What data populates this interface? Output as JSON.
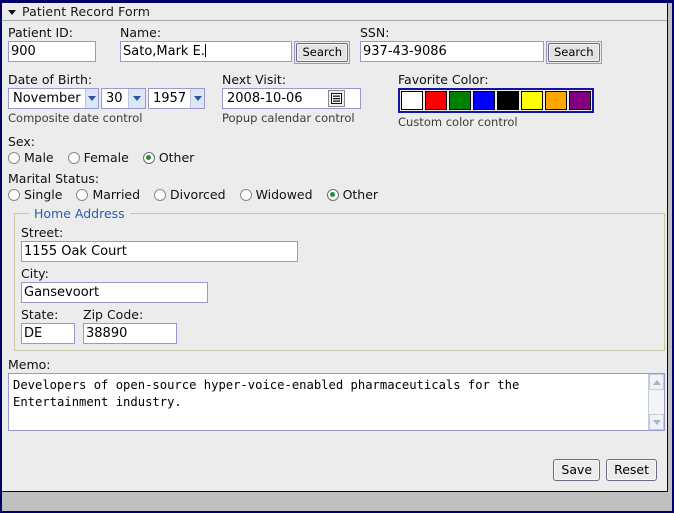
{
  "window": {
    "title": "Patient Record Form",
    "collapse_icon": "triangle-down-icon"
  },
  "fields": {
    "patient_id": {
      "label": "Patient ID:",
      "value": "900"
    },
    "name": {
      "label": "Name:",
      "value": "Sato,Mark E.",
      "search_button": "Search"
    },
    "ssn": {
      "label": "SSN:",
      "value": "937-43-9086",
      "search_button": "Search"
    },
    "dob": {
      "label": "Date of Birth:",
      "hint": "Composite date control",
      "month": "November",
      "day": "30",
      "year": "1957"
    },
    "next_visit": {
      "label": "Next Visit:",
      "hint": "Popup calendar control",
      "value": "2008-10-06",
      "calendar_icon": "calendar-icon"
    },
    "favorite_color": {
      "label": "Favorite Color:",
      "hint": "Custom color control",
      "swatches": [
        {
          "name": "white",
          "hex": "#ffffff",
          "selected": false
        },
        {
          "name": "red",
          "hex": "#ff0000",
          "selected": false
        },
        {
          "name": "green",
          "hex": "#008000",
          "selected": false
        },
        {
          "name": "blue",
          "hex": "#0000ff",
          "selected": false
        },
        {
          "name": "black",
          "hex": "#000000",
          "selected": false
        },
        {
          "name": "yellow",
          "hex": "#ffff00",
          "selected": false
        },
        {
          "name": "orange",
          "hex": "#ffa500",
          "selected": false
        },
        {
          "name": "purple",
          "hex": "#800080",
          "selected": false
        }
      ]
    },
    "sex": {
      "label": "Sex:",
      "options": [
        {
          "label": "Male",
          "selected": false
        },
        {
          "label": "Female",
          "selected": false
        },
        {
          "label": "Other",
          "selected": true
        }
      ]
    },
    "marital_status": {
      "label": "Marital Status:",
      "options": [
        {
          "label": "Single",
          "selected": false
        },
        {
          "label": "Married",
          "selected": false
        },
        {
          "label": "Divorced",
          "selected": false
        },
        {
          "label": "Widowed",
          "selected": false
        },
        {
          "label": "Other",
          "selected": true
        }
      ]
    },
    "home_address": {
      "legend": "Home Address",
      "street": {
        "label": "Street:",
        "value": "1155 Oak Court"
      },
      "city": {
        "label": "City:",
        "value": "Gansevoort"
      },
      "state": {
        "label": "State:",
        "value": "DE"
      },
      "zip": {
        "label": "Zip Code:",
        "value": "38890"
      }
    },
    "memo": {
      "label": "Memo:",
      "value": "Developers of open-source hyper-voice-enabled pharmaceuticals for the\nEntertainment industry."
    }
  },
  "actions": {
    "save": "Save",
    "reset": "Reset"
  },
  "colors": {
    "accent": "#2a5db0",
    "frame": "#000066",
    "radio_dot": "#2e8b2e",
    "panel_bg": "#ececec",
    "page_bg": "#bfbfbf"
  }
}
